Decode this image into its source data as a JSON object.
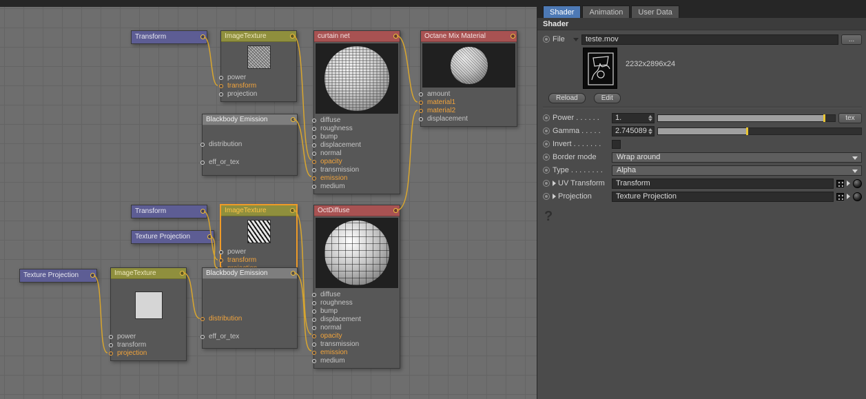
{
  "colors": {
    "accent_orange": "#f2a43c",
    "wire": "#d9a62e",
    "tab_active_blue": "#4d79b5",
    "node_header_red": "#a85252",
    "node_header_olive": "#8f8f3d",
    "node_header_purple": "#5d5d94",
    "node_header_gray": "#7e7e7e",
    "canvas_background": "#6e6e6e",
    "panel_background": "#4b4b4b",
    "slider_tick_yellow": "#e9c531"
  },
  "icons": {
    "keyframe_circle": "circle-dot",
    "file_menu_arrow": "triangle-down",
    "dropdown_arrow": "triangle-down",
    "expander_arrow": "triangle-right",
    "datatype_grid": "dot-grid",
    "node_ball": "dark-sphere",
    "stepper": "up-down-arrows",
    "output_port": "yellow-ring",
    "input_port": "gray-ring"
  },
  "canvas": {
    "nodes": {
      "transform_top": {
        "title": "Transform"
      },
      "imagetexture_top": {
        "title": "ImageTexture",
        "inputs": [
          "power",
          "transform",
          "projection"
        ]
      },
      "blackbody_top": {
        "title": "Blackbody Emission",
        "inputs": [
          "distribution",
          "eff_or_tex"
        ]
      },
      "curtain_net": {
        "title": "curtain net",
        "inputs": [
          "diffuse",
          "roughness",
          "bump",
          "displacement",
          "normal",
          "opacity",
          "transmission",
          "emission",
          "medium"
        ]
      },
      "mix_material": {
        "title": "Octane Mix Material",
        "inputs": [
          "amount",
          "material1",
          "material2",
          "displacement"
        ]
      },
      "transform_mid": {
        "title": "Transform"
      },
      "texture_projection_mid": {
        "title": "Texture Projection"
      },
      "imagetexture_mid": {
        "title": "ImageTexture",
        "inputs": [
          "power",
          "transform",
          "projection"
        ]
      },
      "octdiffuse": {
        "title": "OctDiffuse",
        "inputs": [
          "diffuse",
          "roughness",
          "bump",
          "displacement",
          "normal",
          "opacity",
          "transmission",
          "emission",
          "medium"
        ]
      },
      "texture_projection_bottom": {
        "title": "Texture Projection"
      },
      "imagetexture_bottom": {
        "title": "ImageTexture",
        "inputs": [
          "power",
          "transform",
          "projection"
        ]
      },
      "blackbody_bottom": {
        "title": "Blackbody Emission",
        "inputs": [
          "distribution",
          "eff_or_tex"
        ]
      }
    }
  },
  "panel": {
    "tabs": [
      "Shader",
      "Animation",
      "User Data"
    ],
    "section_title": "Shader",
    "file": {
      "label": "File",
      "value": "teste.mov",
      "browse": "..."
    },
    "preview": {
      "dimensions": "2232x2896x24"
    },
    "reload_button": "Reload",
    "edit_button": "Edit",
    "power": {
      "label": "Power . . . . . .",
      "value": "1.",
      "tex_button": "tex"
    },
    "gamma": {
      "label": "Gamma . . . . .",
      "value": "2.745089"
    },
    "invert": {
      "label": "Invert . . . . . . ."
    },
    "border_mode": {
      "label": "Border mode",
      "value": "Wrap around"
    },
    "type": {
      "label": "Type . . . . . . . .",
      "value": "Alpha"
    },
    "uv_transform": {
      "label": "UV Transform",
      "value": "Transform"
    },
    "projection": {
      "label": "Projection",
      "value": "Texture Projection"
    },
    "help": "?"
  }
}
